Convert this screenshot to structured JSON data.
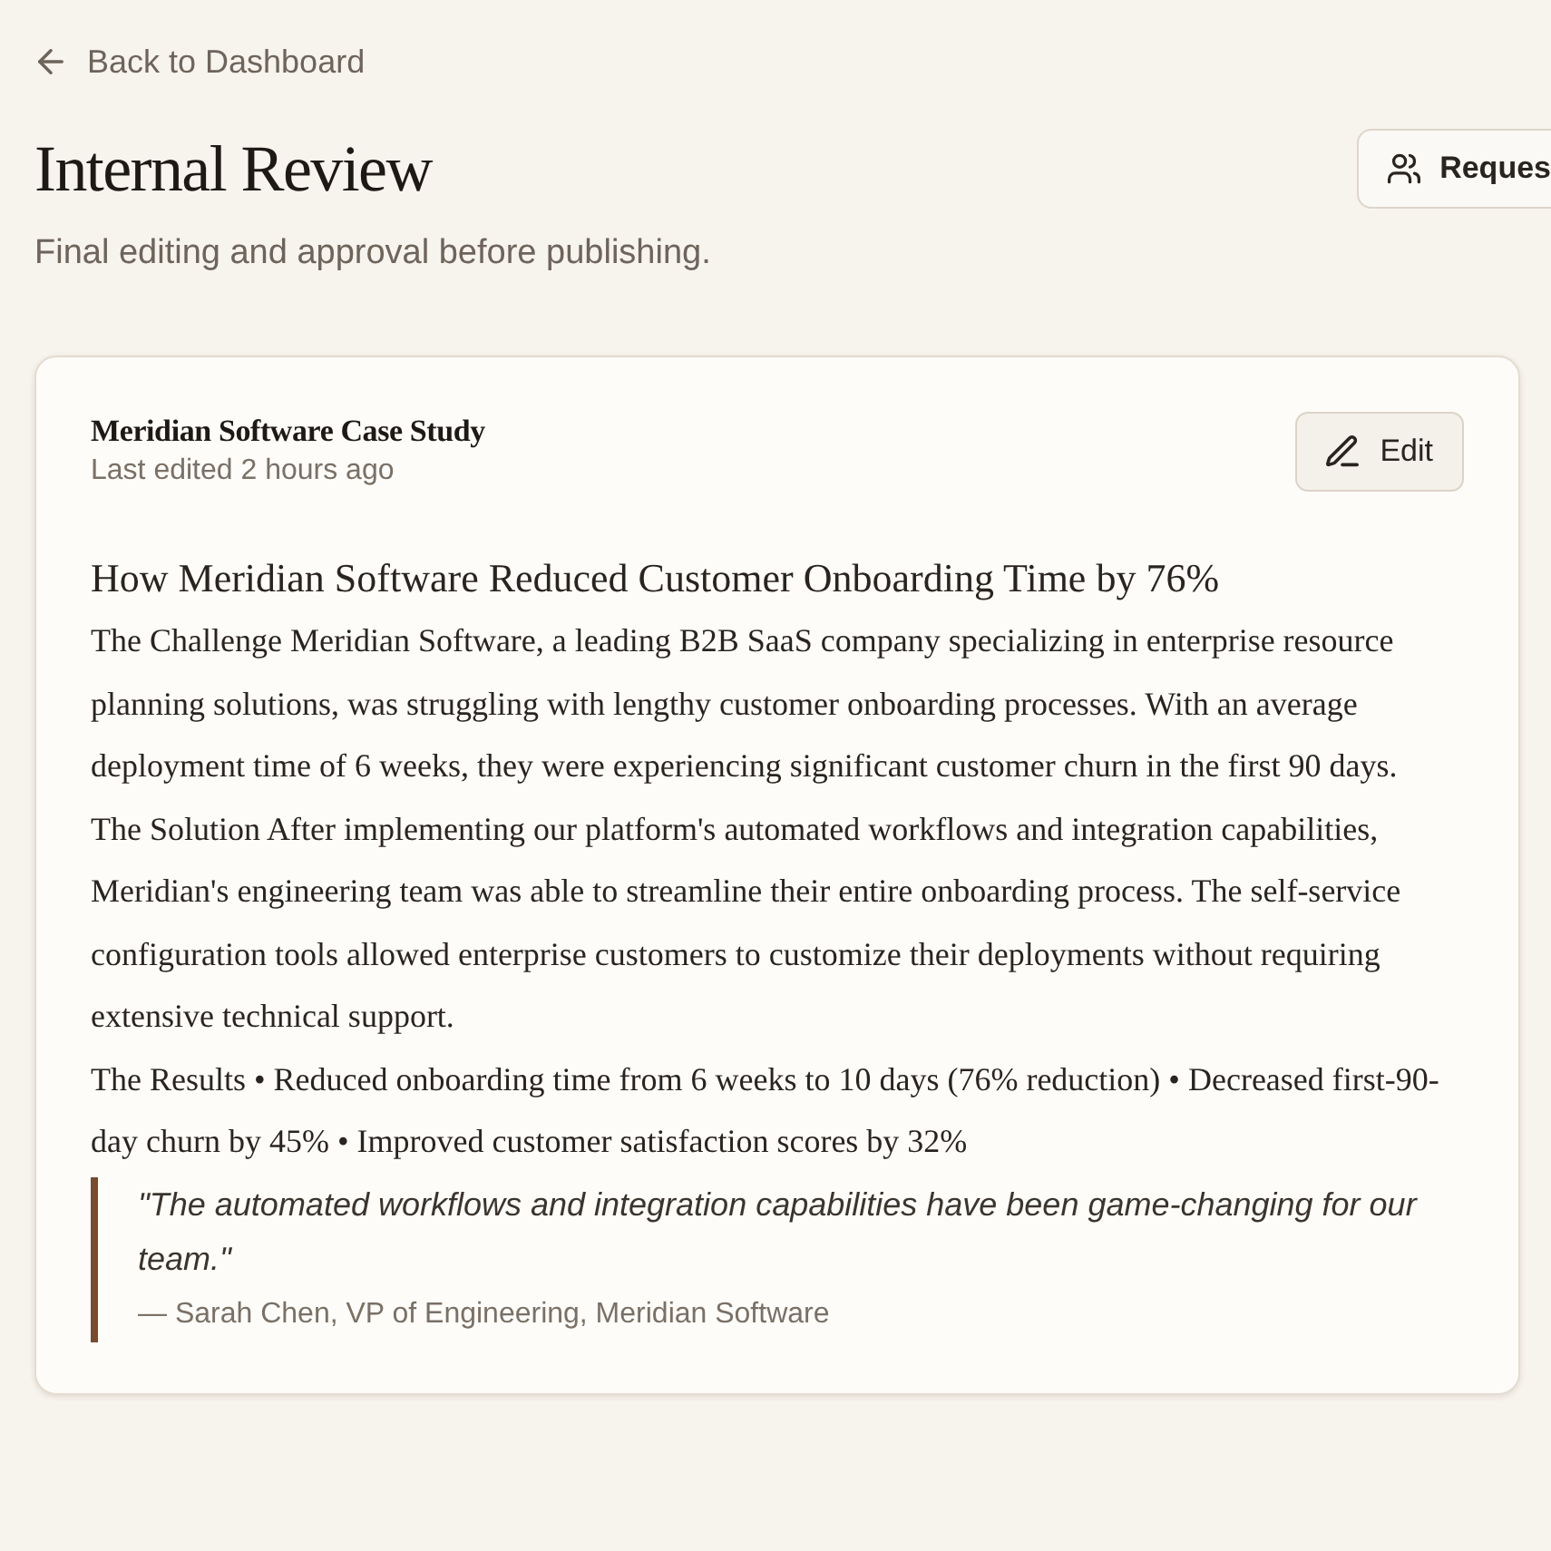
{
  "back_link": {
    "label": "Back to Dashboard"
  },
  "header": {
    "title": "Internal Review",
    "subtitle": "Final editing and approval before publishing.",
    "action": {
      "label": "Reques"
    }
  },
  "document": {
    "title": "Meridian Software Case Study",
    "meta": "Last edited 2 hours ago",
    "edit_button": {
      "label": "Edit"
    },
    "content": {
      "heading": "How Meridian Software Reduced Customer Onboarding Time by 76%",
      "paragraphs": [
        "The Challenge Meridian Software, a leading B2B SaaS company specializing in enterprise resource planning solutions, was struggling with lengthy customer onboarding processes. With an average deployment time of 6 weeks, they were experiencing significant customer churn in the first 90 days.",
        "The Solution After implementing our platform's automated workflows and integration capabilities, Meridian's engineering team was able to streamline their entire onboarding process. The self-service configuration tools allowed enterprise customers to customize their deployments without requiring extensive technical support.",
        "The Results • Reduced onboarding time from 6 weeks to 10 days (76% reduction) • Decreased first-90-day churn by 45% • Improved customer satisfaction scores by 32%"
      ],
      "quote": {
        "text": "\"The automated workflows and integration capabilities have been game-changing for our team.\"",
        "attribution": "— Sarah Chen, VP of Engineering, Meridian Software"
      }
    }
  }
}
